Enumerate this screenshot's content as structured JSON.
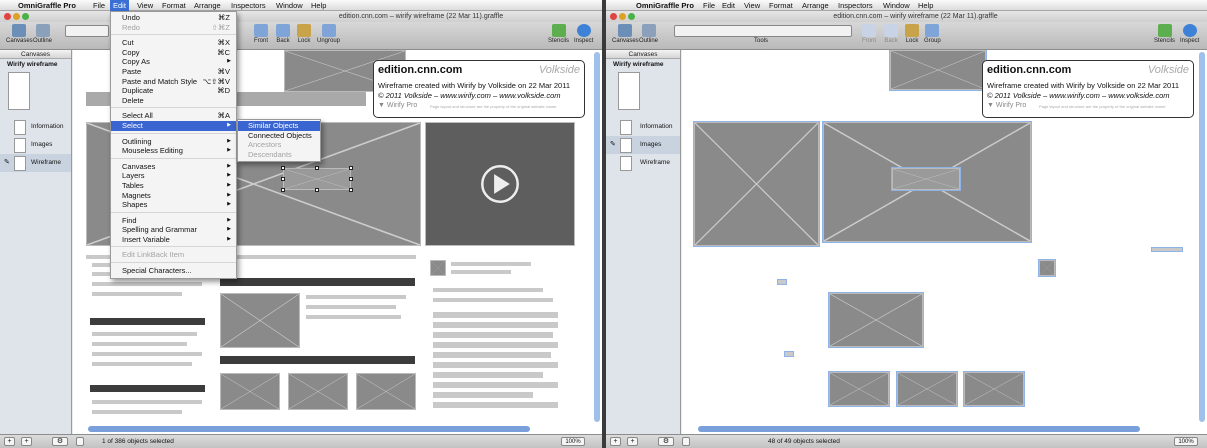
{
  "left": {
    "menubar": {
      "app": "OmniGraffle Pro",
      "items": [
        "File",
        "Edit",
        "View",
        "Format",
        "Arrange",
        "Inspectors",
        "Window",
        "Help"
      ]
    },
    "window_title": "edition.cnn.com – wirify wireframe (22 Mar 11).graffle",
    "toolbar": {
      "canvases": "Canvases",
      "outline": "Outline",
      "front": "Front",
      "back": "Back",
      "lock": "Lock",
      "ungroup": "Ungroup",
      "stencils": "Stencils",
      "inspect": "Inspect"
    },
    "sidebar": {
      "header": "Canvases",
      "canvas_name": "Wirify wireframe",
      "layers": [
        "Information",
        "Images",
        "Wireframe"
      ]
    },
    "status": "1 of 386 objects selected",
    "zoom": "100%",
    "edit_menu": {
      "items": [
        {
          "label": "Undo",
          "shortcut": "⌘Z"
        },
        {
          "label": "Redo",
          "shortcut": "⇧⌘Z",
          "disabled": true
        },
        {
          "sep": true
        },
        {
          "label": "Cut",
          "shortcut": "⌘X"
        },
        {
          "label": "Copy",
          "shortcut": "⌘C"
        },
        {
          "label": "Copy As",
          "submenu": true
        },
        {
          "label": "Paste",
          "shortcut": "⌘V"
        },
        {
          "label": "Paste and Match Style",
          "shortcut": "⌥⇧⌘V"
        },
        {
          "label": "Duplicate",
          "shortcut": "⌘D"
        },
        {
          "label": "Delete"
        },
        {
          "sep": true
        },
        {
          "label": "Select All",
          "shortcut": "⌘A"
        },
        {
          "label": "Select",
          "submenu": true,
          "highlighted": true
        },
        {
          "sep": true
        },
        {
          "label": "Outlining",
          "submenu": true
        },
        {
          "label": "Mouseless Editing",
          "submenu": true
        },
        {
          "sep": true
        },
        {
          "label": "Canvases",
          "submenu": true
        },
        {
          "label": "Layers",
          "submenu": true
        },
        {
          "label": "Tables",
          "submenu": true
        },
        {
          "label": "Magnets",
          "submenu": true
        },
        {
          "label": "Shapes",
          "submenu": true
        },
        {
          "sep": true
        },
        {
          "label": "Find",
          "submenu": true
        },
        {
          "label": "Spelling and Grammar",
          "submenu": true
        },
        {
          "label": "Insert Variable",
          "submenu": true
        },
        {
          "sep": true
        },
        {
          "label": "Edit LinkBack Item",
          "disabled": true
        },
        {
          "sep": true
        },
        {
          "label": "Special Characters..."
        }
      ]
    },
    "select_submenu": [
      {
        "label": "Similar Objects",
        "highlighted": true
      },
      {
        "label": "Connected Objects"
      },
      {
        "label": "Ancestors",
        "disabled": true
      },
      {
        "label": "Descendants",
        "disabled": true
      }
    ]
  },
  "right": {
    "menubar": {
      "app": "OmniGraffle Pro",
      "items": [
        "File",
        "Edit",
        "View",
        "Format",
        "Arrange",
        "Inspectors",
        "Window",
        "Help"
      ]
    },
    "window_title": "edition.cnn.com – wirify wireframe (22 Mar 11).graffle",
    "toolbar": {
      "canvases": "Canvases",
      "outline": "Outline",
      "tools": "Tools",
      "front": "Front",
      "back": "Back",
      "lock": "Lock",
      "group": "Group",
      "stencils": "Stencils",
      "inspect": "Inspect"
    },
    "sidebar": {
      "header": "Canvases",
      "canvas_name": "Wirify wireframe",
      "layers": [
        "Information",
        "Images",
        "Wireframe"
      ]
    },
    "status": "48 of 49 objects selected",
    "zoom": "100%"
  },
  "note": {
    "site": "edition.cnn.com",
    "brand": "Volkside",
    "line1": "Wireframe created with Wirify by Volkside on 22 Mar 2011",
    "line2": "© 2011 Volkside  –  www.wirify.com  –  www.volkside.com",
    "product": "Wirify Pro",
    "fine": "Page layout and structure are the property of the original website owner"
  },
  "colors": {
    "menu_highlight": "#3a64cf",
    "placeholder": "#8a8a8a",
    "selection": "#8fb3e6"
  }
}
